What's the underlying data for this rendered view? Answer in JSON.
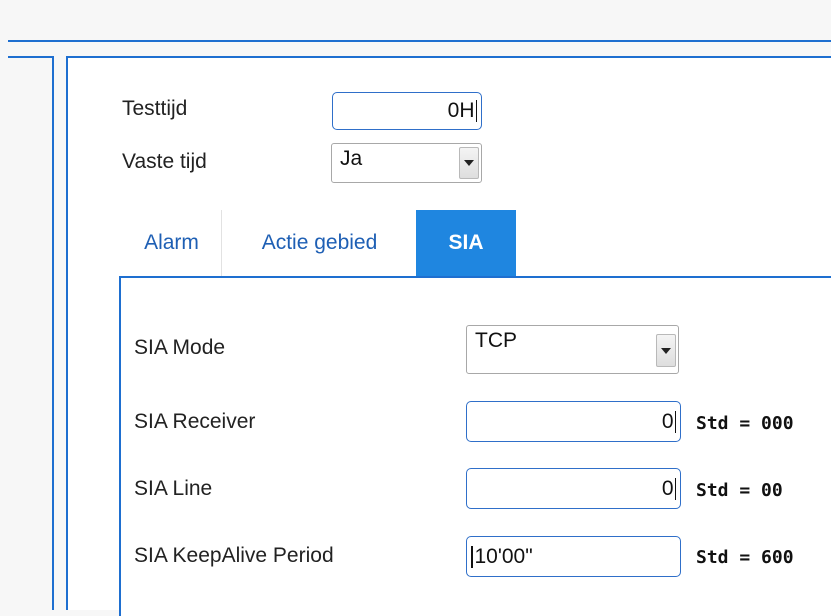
{
  "header": {
    "testtijd": {
      "label": "Testtijd",
      "value": "0H"
    },
    "vaste_tijd": {
      "label": "Vaste tijd",
      "value": "Ja"
    }
  },
  "tabs": [
    {
      "label": "Alarm",
      "active": false
    },
    {
      "label": "Actie gebied",
      "active": false
    },
    {
      "label": "SIA",
      "active": true
    }
  ],
  "sia": {
    "mode": {
      "label": "SIA Mode",
      "value": "TCP"
    },
    "receiver": {
      "label": "SIA Receiver",
      "value": "0",
      "std": "Std = 000"
    },
    "line": {
      "label": "SIA Line",
      "value": "0",
      "std": "Std = 00"
    },
    "keepalive": {
      "label": "SIA KeepAlive Period",
      "value": "10'00\"",
      "std": "Std = 600"
    }
  },
  "colors": {
    "accent": "#1e6fd0",
    "active_tab": "#1f86e0",
    "tab_text": "#1e5fb4"
  }
}
